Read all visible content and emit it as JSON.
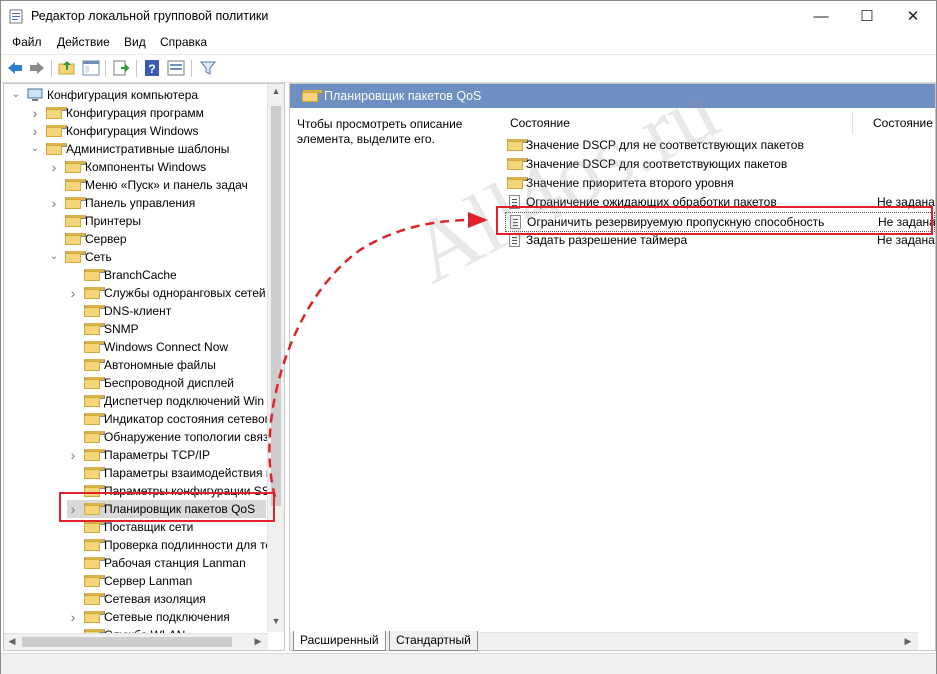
{
  "window": {
    "title": "Редактор локальной групповой политики"
  },
  "titlebar_buttons": {
    "minimize": "—",
    "maximize": "☐",
    "close": "✕"
  },
  "menu": [
    "Файл",
    "Действие",
    "Вид",
    "Справка"
  ],
  "toolbar_icons": [
    "back-arrow-icon",
    "forward-arrow-icon",
    "up-folder-icon",
    "show-hide-tree-icon",
    "export-list-icon",
    "help-icon",
    "properties-icon",
    "filter-icon"
  ],
  "tree": {
    "root": "Конфигурация компьютера",
    "items": [
      {
        "label": "Конфигурация программ"
      },
      {
        "label": "Конфигурация Windows"
      },
      {
        "label": "Административные шаблоны"
      },
      {
        "label": "Компоненты Windows"
      },
      {
        "label": "Меню «Пуск» и панель задач"
      },
      {
        "label": "Панель управления"
      },
      {
        "label": "Принтеры"
      },
      {
        "label": "Сервер"
      },
      {
        "label": "Сеть"
      },
      {
        "label": "BranchCache"
      },
      {
        "label": "Службы одноранговых сетей"
      },
      {
        "label": "DNS-клиент"
      },
      {
        "label": "SNMP"
      },
      {
        "label": "Windows Connect Now"
      },
      {
        "label": "Автономные файлы"
      },
      {
        "label": "Беспроводной дисплей"
      },
      {
        "label": "Диспетчер подключений Win"
      },
      {
        "label": "Индикатор состояния сетевог"
      },
      {
        "label": "Обнаружение топологии связ"
      },
      {
        "label": "Параметры TCP/IP"
      },
      {
        "label": "Параметры взаимодействия к"
      },
      {
        "label": "Параметры конфигурации SS"
      },
      {
        "label": "Планировщик пакетов QoS"
      },
      {
        "label": "Поставщик сети"
      },
      {
        "label": "Проверка подлинности для те"
      },
      {
        "label": "Рабочая станция Lanman"
      },
      {
        "label": "Сервер Lanman"
      },
      {
        "label": "Сетевая изоляция"
      },
      {
        "label": "Сетевые подключения"
      },
      {
        "label": "Служба WLAN"
      }
    ]
  },
  "right": {
    "header_title": "Планировщик пакетов QoS",
    "description": "Чтобы просмотреть описание элемента, выделите его.",
    "col_setting": "Состояние",
    "col_state": "Состояние",
    "rows": [
      {
        "label": "Значение DSCP для не соответствующих пакетов",
        "state": ""
      },
      {
        "label": "Значение DSCP для соответствующих пакетов",
        "state": ""
      },
      {
        "label": "Значение приоритета второго уровня",
        "state": ""
      },
      {
        "label": "Ограничение ожидающих обработки пакетов",
        "state": "Не задана"
      },
      {
        "label": "Ограничить резервируемую пропускную способность",
        "state": "Не задана"
      },
      {
        "label": "Задать разрешение таймера",
        "state": "Не задана"
      }
    ]
  },
  "tabs": [
    "Расширенный",
    "Стандартный"
  ],
  "watermark": "All4os.ru",
  "colors": {
    "accent": "#6d8fc2",
    "highlight": "#e0222a",
    "folder": "#f5d57a"
  }
}
